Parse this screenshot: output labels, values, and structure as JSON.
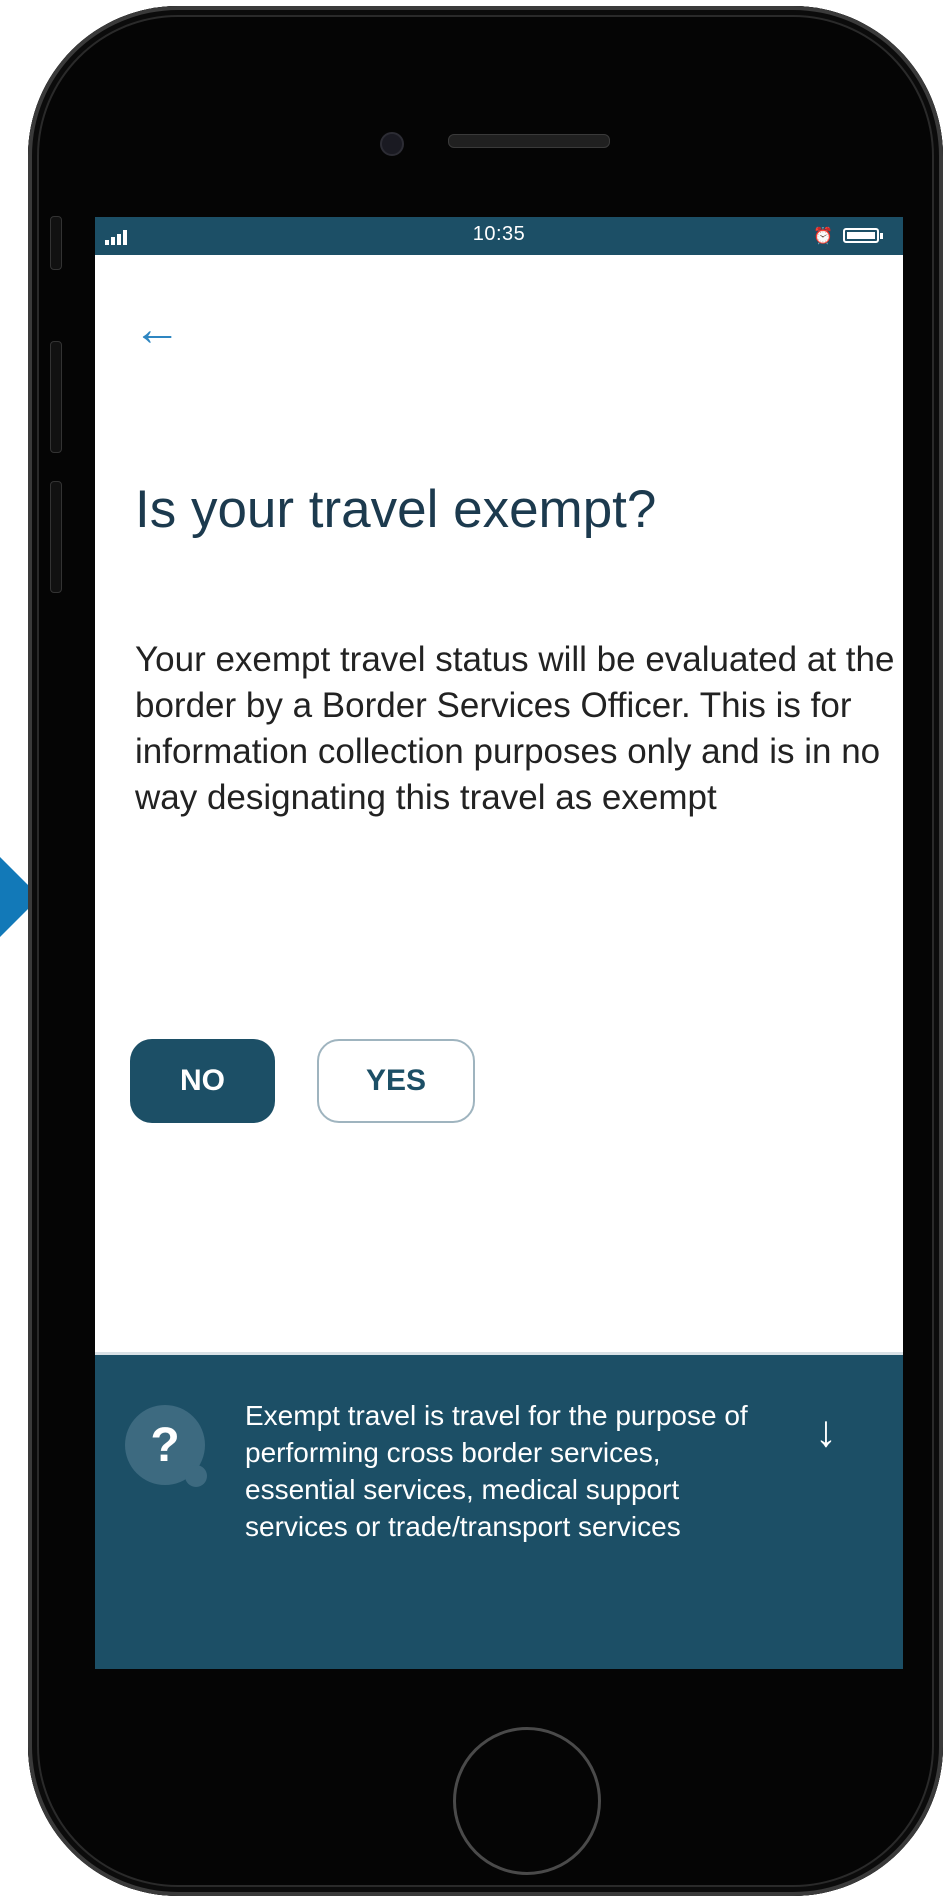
{
  "status_bar": {
    "time": "10:35"
  },
  "header": {
    "back_icon": "←"
  },
  "question": {
    "title": "Is your travel exempt?",
    "description": "Your exempt travel status will be evaluated at the border by a Border Services Officer. This is for information collection purposes only and is in no way designating this travel as exempt"
  },
  "options": {
    "no_label": "NO",
    "yes_label": "YES",
    "selected": "NO"
  },
  "help": {
    "icon": "?",
    "text": "Exempt travel is travel for the purpose of performing cross border services, essential services, medical support services or trade/transport services",
    "arrow": "↓"
  },
  "colors": {
    "primary": "#1c4f66",
    "accent": "#2e86c1",
    "pointer": "#1279b8"
  }
}
